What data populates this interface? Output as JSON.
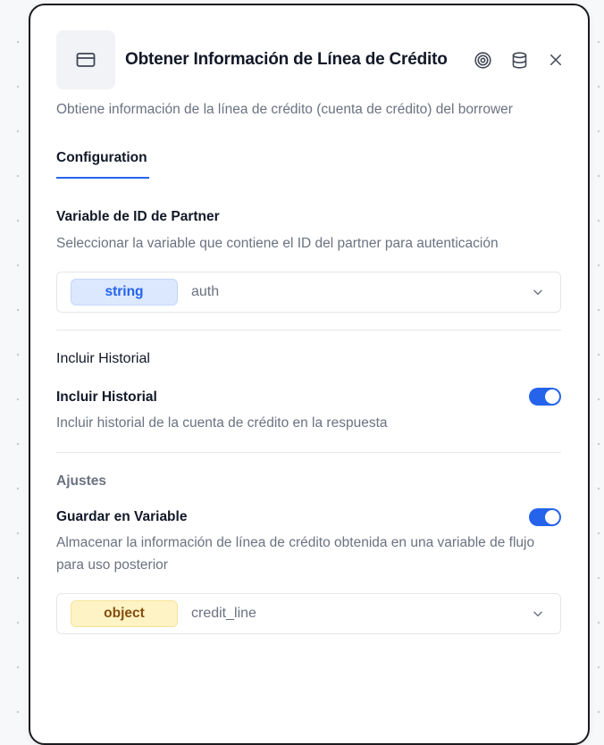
{
  "panel": {
    "title": "Obtener Información de Línea de Crédito",
    "description": "Obtiene información de la línea de crédito (cuenta de crédito) del borrower",
    "node_icon": "credit-card-icon",
    "actions": [
      "target-icon",
      "database-icon",
      "close-icon"
    ]
  },
  "tabs": [
    {
      "label": "Configuration",
      "active": true
    }
  ],
  "partner_field": {
    "label": "Variable de ID de Partner",
    "help": "Seleccionar la variable que contiene el ID del partner para autenticación",
    "type": "string",
    "value": "auth"
  },
  "history_section": {
    "title": "Incluir Historial",
    "toggle_label": "Incluir Historial",
    "toggle_help": "Incluir historial de la cuenta de crédito en la respuesta",
    "enabled": true
  },
  "settings_section": {
    "title": "Ajustes",
    "toggle_label": "Guardar en Variable",
    "toggle_help_line1": "Almacenar la información de línea de crédito obtenida en una variable de flujo",
    "toggle_help_line2": "para uso posterior",
    "enabled": true,
    "type": "object",
    "value": "credit_line"
  },
  "colors": {
    "accent": "#2563eb",
    "string_pill_bg": "#dbe8fd",
    "object_pill_bg": "#fdf3c4"
  }
}
